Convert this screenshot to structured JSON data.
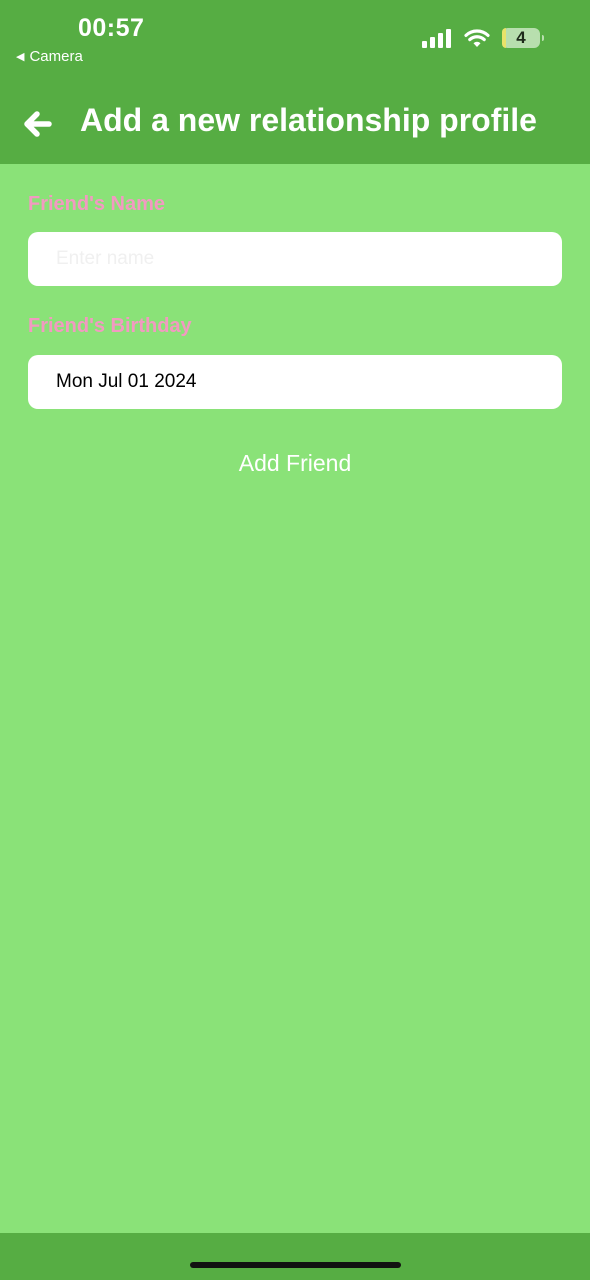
{
  "status_bar": {
    "time": "00:57",
    "back_app_label": "Camera",
    "battery_level": "4"
  },
  "header": {
    "title": "Add a new relationship profile"
  },
  "form": {
    "name_label": "Friend's Name",
    "name_placeholder": "Enter name",
    "name_value": "",
    "birthday_label": "Friend's Birthday",
    "birthday_value": "Mon Jul 01 2024",
    "submit_label": "Add Friend"
  },
  "colors": {
    "header_bg": "#56ad43",
    "page_bg": "#8ae278",
    "label_color": "#f29ac1",
    "button_text": "#ffffff"
  }
}
